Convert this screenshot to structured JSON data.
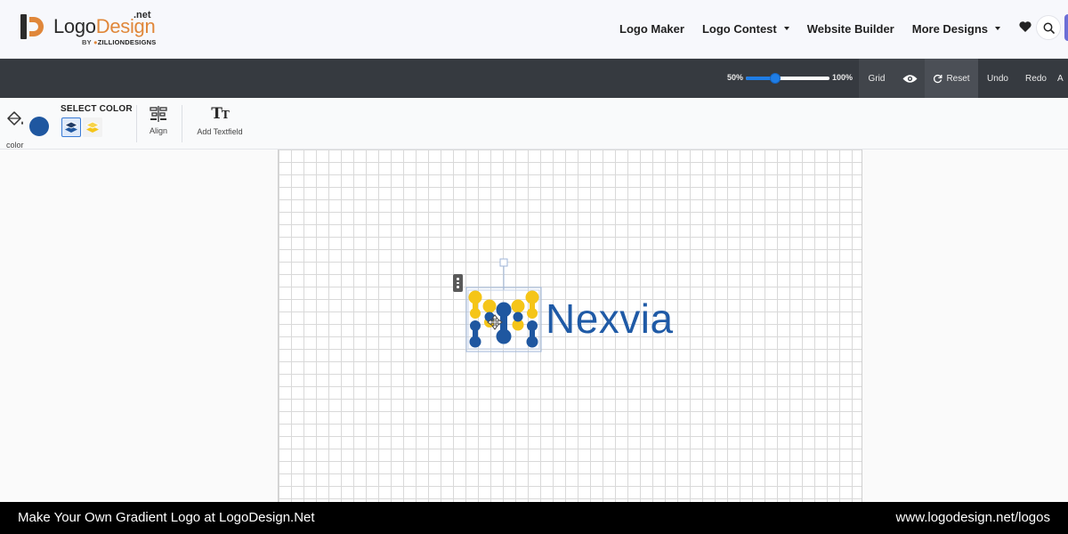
{
  "site": {
    "logo_main": "Logo",
    "logo_accent": "Design",
    "logo_tld": ".net",
    "logo_by": "BY",
    "logo_company": "ZILLIONDESIGNS"
  },
  "nav": {
    "items": [
      {
        "label": "Logo Maker",
        "dropdown": false
      },
      {
        "label": "Logo Contest",
        "dropdown": true
      },
      {
        "label": "Website Builder",
        "dropdown": false
      },
      {
        "label": "More Designs",
        "dropdown": true
      }
    ],
    "icons": [
      "heart-icon",
      "search-icon"
    ]
  },
  "editor_toolbar": {
    "zoom_min": "50%",
    "zoom_max": "100%",
    "zoom_fraction": 0.35,
    "grid_label": "Grid",
    "reset_label": "Reset",
    "undo_label": "Undo",
    "redo_label": "Redo",
    "cut_off_label": "A"
  },
  "properties": {
    "fill_label": "color",
    "current_color": "#1f57a0",
    "select_color_title": "SELECT COLOR",
    "layer_colors": [
      "#1f57a0",
      "#f5c518"
    ],
    "align_label": "Align",
    "add_text_label": "Add Textfield"
  },
  "canvas": {
    "brand_name": "Nexvia",
    "brand_color": "#1f5aa6",
    "symbol_colors": {
      "blue": "#1f57a0",
      "yellow": "#f5c518"
    }
  },
  "footer": {
    "left_text": "Make Your Own Gradient Logo at LogoDesign.Net",
    "right_text": "www.logodesign.net/logos"
  }
}
